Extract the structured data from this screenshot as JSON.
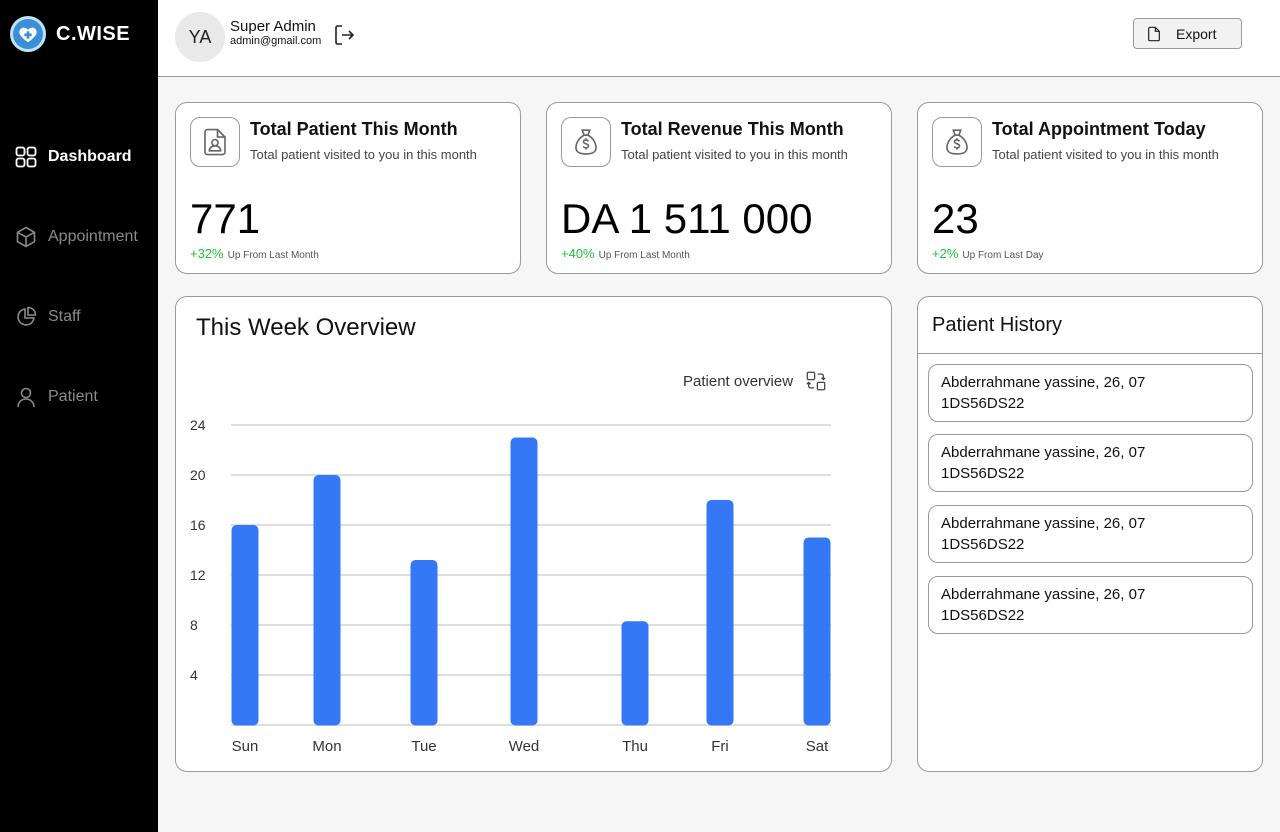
{
  "brand": {
    "name": "C.WISE"
  },
  "sidebar": {
    "items": [
      {
        "label": "Dashboard",
        "icon": "grid-icon",
        "active": true
      },
      {
        "label": "Appointment",
        "icon": "cube-icon",
        "active": false
      },
      {
        "label": "Staff",
        "icon": "pie-icon",
        "active": false
      },
      {
        "label": "Patient",
        "icon": "user-icon",
        "active": false
      }
    ]
  },
  "header": {
    "avatar_initials": "YA",
    "user_name": "Super Admin",
    "user_email": "admin@gmail.com",
    "export_label": "Export"
  },
  "stats": [
    {
      "title": "Total Patient This Month",
      "subtitle": "Total patient visited to you in this month",
      "value": "771",
      "change": "+32%",
      "change_text": "Up From Last Month",
      "icon": "patient-card-icon"
    },
    {
      "title": "Total Revenue This Month",
      "subtitle": "Total patient visited to you in this month",
      "value": "DA 1 511 000",
      "change": "+40%",
      "change_text": "Up From Last Month",
      "icon": "money-bag-icon"
    },
    {
      "title": "Total Appointment Today",
      "subtitle": "Total patient visited to you in this month",
      "value": "23",
      "change": "+2%",
      "change_text": "Up From Last Day",
      "icon": "money-bag-icon"
    }
  ],
  "overview": {
    "title": "This Week Overview",
    "toggle_label": "Patient overview"
  },
  "chart_data": {
    "type": "bar",
    "categories": [
      "Sun",
      "Mon",
      "Tue",
      "Wed",
      "Thu",
      "Fri",
      "Sat"
    ],
    "values": [
      16,
      20,
      13.2,
      23,
      8.3,
      18,
      15
    ],
    "ylim": [
      0,
      24
    ],
    "yticks": [
      4,
      8,
      12,
      16,
      20,
      24
    ],
    "grid": true,
    "bar_color": "#3478f6"
  },
  "history": {
    "title": "Patient History",
    "items": [
      {
        "line1": "Abderrahmane yassine, 26, 07",
        "line2": "1DS56DS22"
      },
      {
        "line1": "Abderrahmane yassine, 26, 07",
        "line2": "1DS56DS22"
      },
      {
        "line1": "Abderrahmane yassine, 26, 07",
        "line2": "1DS56DS22"
      },
      {
        "line1": "Abderrahmane yassine, 26, 07",
        "line2": "1DS56DS22"
      }
    ]
  }
}
